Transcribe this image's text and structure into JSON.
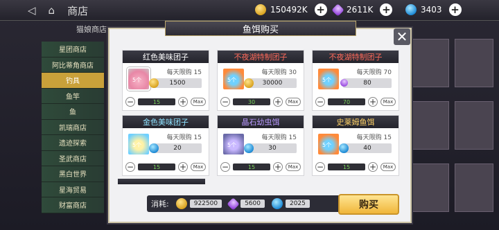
{
  "topbar": {
    "title": "商店",
    "currencies": [
      {
        "name": "gold",
        "value": "150492K"
      },
      {
        "name": "gem",
        "value": "2611K"
      },
      {
        "name": "blue",
        "value": "3403"
      }
    ]
  },
  "tabs_row": {
    "label": "猫娘商店"
  },
  "side_menu": [
    "星团商店",
    "阿比蒂角商店",
    "钓具",
    "鱼竿",
    "鱼",
    "凯瑞商店",
    "遗迹探索",
    "圣武商店",
    "黑白世界",
    "星海贸易",
    "财富商店"
  ],
  "modal": {
    "title": "鱼饵购买",
    "items": [
      {
        "title": "红色美味团子",
        "limit": "每天限购 15",
        "price": "1500",
        "qty": "15",
        "img": "img-pink",
        "title_class": "",
        "currency": "gold",
        "tag": "5个"
      },
      {
        "title": "不夜湖特制团子",
        "limit": "每天限购 30",
        "price": "30000",
        "qty": "30",
        "img": "img-orange",
        "title_class": "red-title",
        "currency": "gold",
        "tag": "5个"
      },
      {
        "title": "不夜湖特制团子",
        "limit": "每天限购 70",
        "price": "80",
        "qty": "70",
        "img": "img-orange",
        "title_class": "red-title",
        "currency": "gem",
        "tag": "5个"
      },
      {
        "title": "金色美味团子",
        "limit": "每天限购 15",
        "price": "20",
        "qty": "15",
        "img": "img-gold",
        "title_class": "cyan-title",
        "currency": "blue",
        "tag": "5个"
      },
      {
        "title": "晶石幼虫饵",
        "limit": "每天限购 15",
        "price": "30",
        "qty": "15",
        "img": "img-purple",
        "title_class": "purple-title",
        "currency": "blue",
        "tag": "5个"
      },
      {
        "title": "史莱姆鱼饵",
        "limit": "每天限购 15",
        "price": "40",
        "qty": "15",
        "img": "img-orange",
        "title_class": "gold-title",
        "currency": "blue",
        "tag": "5个"
      }
    ],
    "footer": {
      "label": "消耗:",
      "costs": [
        {
          "currency": "gold",
          "value": "922500"
        },
        {
          "currency": "gem",
          "value": "5600"
        },
        {
          "currency": "blue",
          "value": "2025"
        }
      ],
      "buy_label": "购买"
    },
    "max_label": "Max"
  }
}
